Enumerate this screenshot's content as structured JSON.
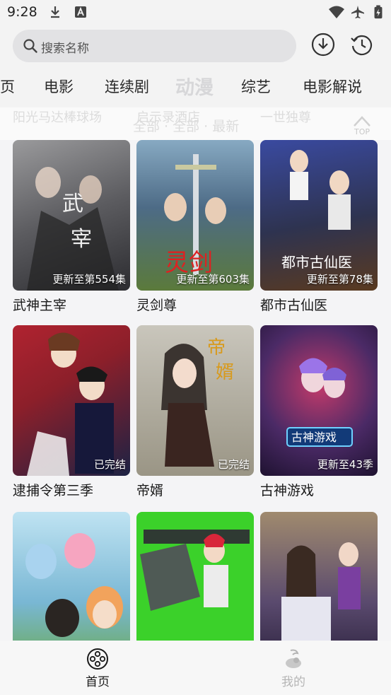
{
  "status_bar": {
    "time": "9:28"
  },
  "search": {
    "placeholder": "搜索名称"
  },
  "tabs": [
    {
      "label": "页"
    },
    {
      "label": "电影"
    },
    {
      "label": "连续剧"
    },
    {
      "label": "动漫"
    },
    {
      "label": "综艺"
    },
    {
      "label": "电影解说"
    }
  ],
  "sub_header": {
    "ghost_row": [
      "阳光马达棒球场",
      "启示录酒店",
      "一世独尊"
    ],
    "filter": "全部 · 全部 · 最新",
    "top_label": "TOP"
  },
  "cards": [
    {
      "title": "武神主宰",
      "badge": "更新至第554集",
      "bg_color": "#6f6f72"
    },
    {
      "title": "灵剑尊",
      "badge": "更新至第603集",
      "bg_color": "#4d6b86"
    },
    {
      "title": "都市古仙医",
      "badge": "更新至第78集",
      "bg_color": "#2e3350"
    },
    {
      "title": "逮捕令第三季",
      "badge": "已完结",
      "bg_color": "#8c1f2a"
    },
    {
      "title": "帝婿",
      "badge": "已完结",
      "bg_color": "#9a9585"
    },
    {
      "title": "古神游戏",
      "badge": "更新至43季",
      "bg_color": "#4b2a66"
    },
    {
      "title": "",
      "badge": "",
      "bg_color": "#79b7d4"
    },
    {
      "title": "",
      "badge": "",
      "bg_color": "#3bd12a"
    },
    {
      "title": "",
      "badge": "",
      "bg_color": "#5a4a6e"
    }
  ],
  "bottom_nav": [
    {
      "label": "首页",
      "active": true
    },
    {
      "label": "我的",
      "active": false
    }
  ],
  "colors": {
    "accent_text": "#1a1a1a",
    "inactive_text": "#b5b5b5",
    "search_bg": "#e2e2e4"
  }
}
